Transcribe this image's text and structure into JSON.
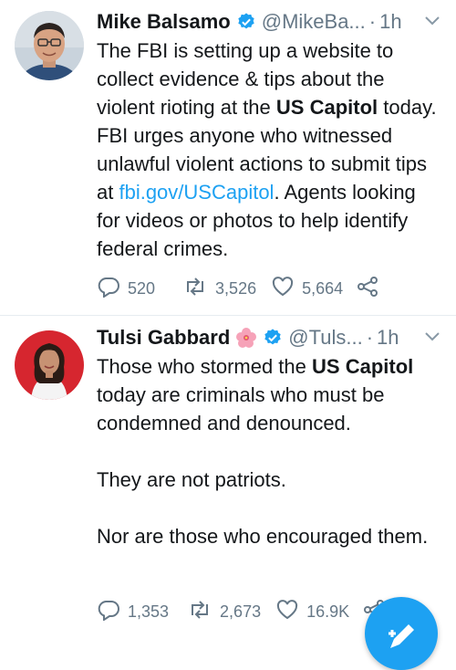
{
  "tweets": [
    {
      "name": "Mike Balsamo",
      "handle": "@MikeBa...",
      "dot": "·",
      "time": "1h",
      "text_a": "The FBI is setting up a website to collect evidence & tips about the violent rioting at the ",
      "text_bold": "US Capitol",
      "text_b": " today. FBI urges anyone who witnessed unlawful violent actions to submit tips at ",
      "link": "fbi.gov/USCapitol",
      "text_c": ". Agents looking for videos or photos to help identify federal crimes.",
      "replies": "520",
      "retweets": "3,526",
      "likes": "5,664"
    },
    {
      "name": "Tulsi Gabbard",
      "handle": "@Tuls...",
      "dot": "·",
      "time": "1h",
      "text_a": "Those who stormed the ",
      "text_bold": "US Capitol",
      "text_b": " today are criminals who must be condemned and denounced.",
      "para2": "They are not patriots.",
      "para3": "Nor are those who encouraged them.",
      "replies": "1,353",
      "retweets": "2,673",
      "likes": "16.9K"
    }
  ],
  "colors": {
    "accent": "#1da1f2",
    "muted": "#657786",
    "text": "#14171a"
  },
  "icons": [
    "verified-badge-icon",
    "hibiscus-emoji-icon",
    "reply-icon",
    "retweet-icon",
    "like-icon",
    "share-icon",
    "chevron-down-icon",
    "compose-tweet-icon"
  ]
}
